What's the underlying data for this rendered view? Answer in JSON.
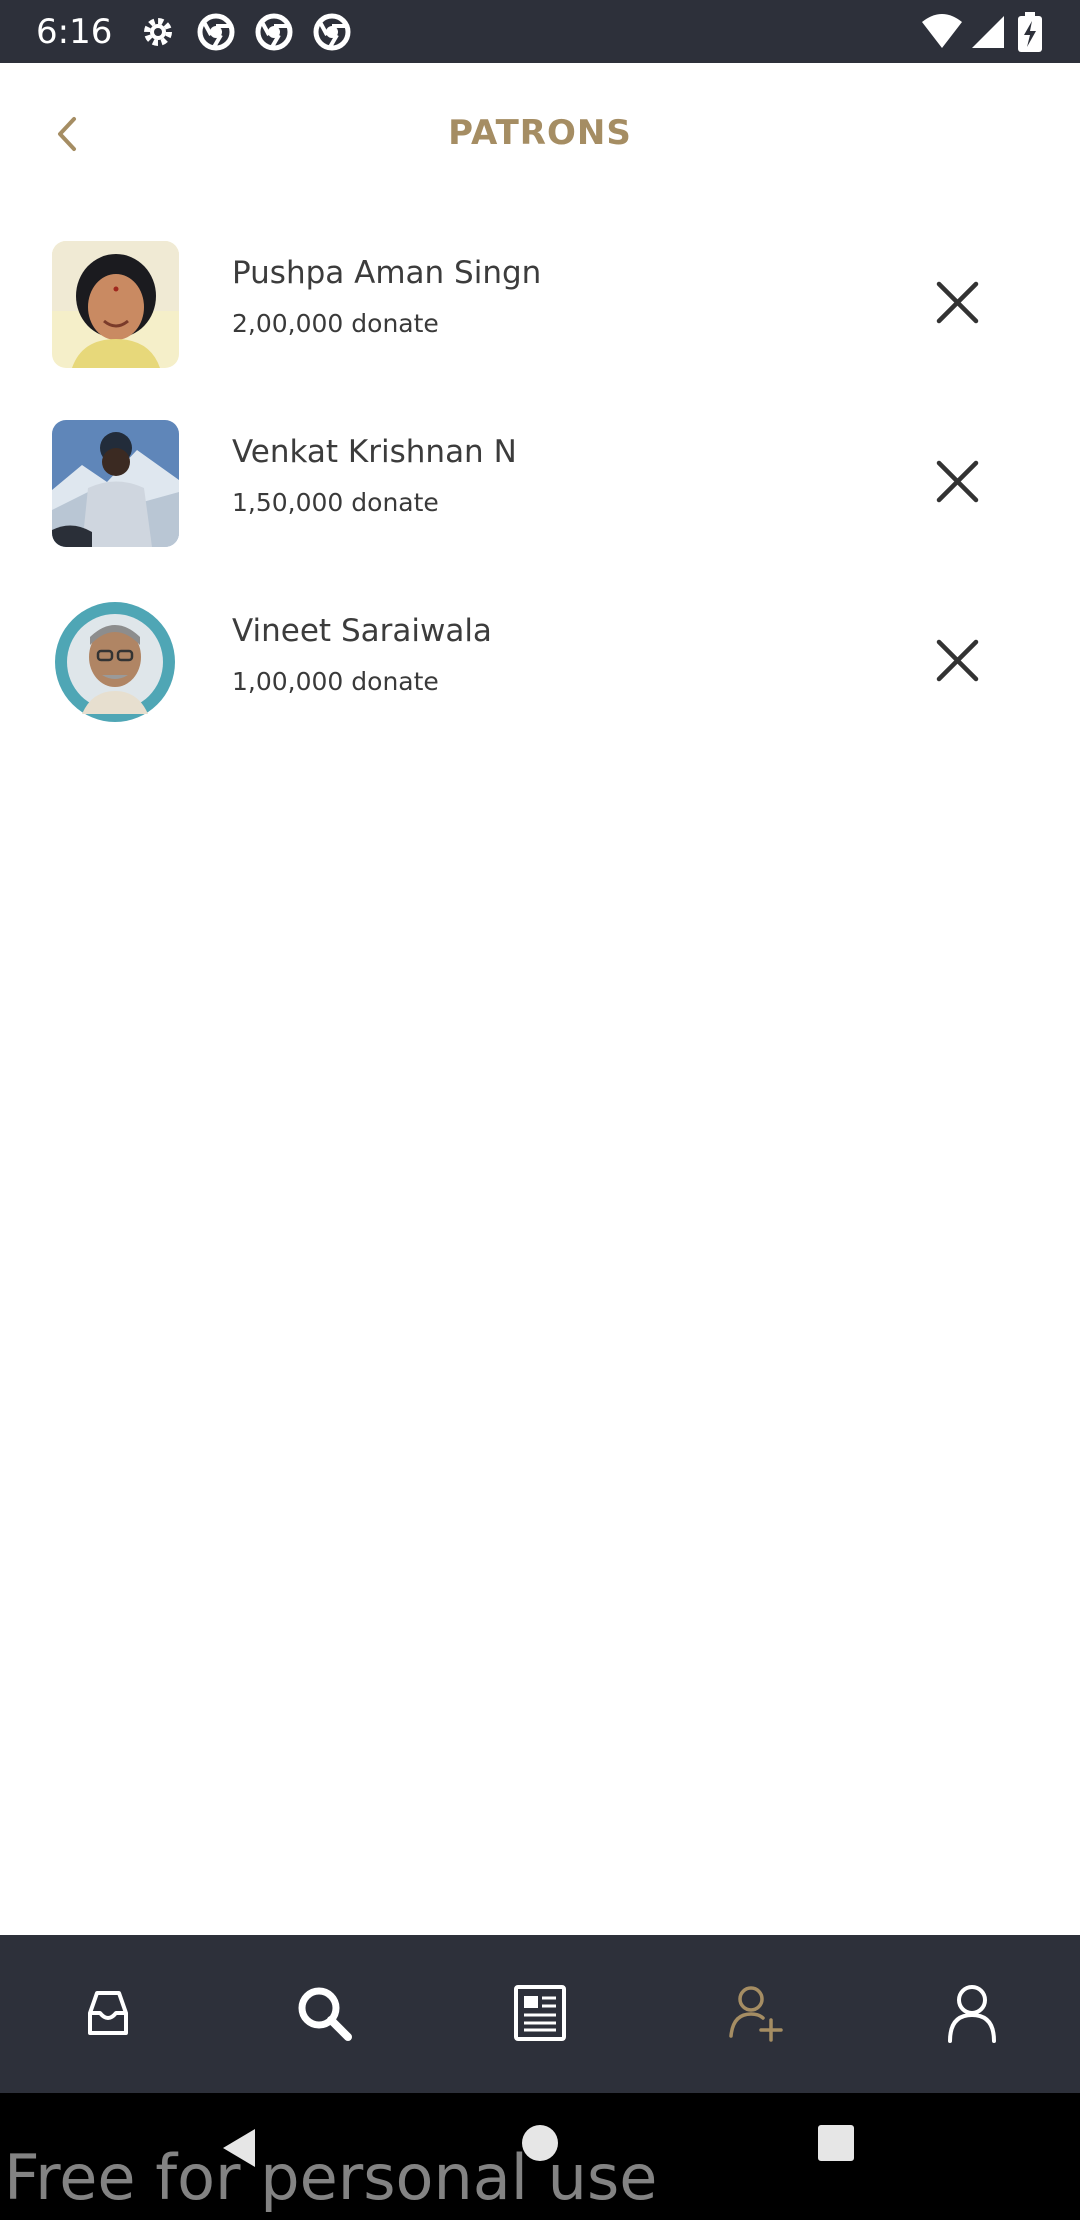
{
  "status_bar": {
    "time": "6:16",
    "icons": [
      "gear-icon",
      "chrome-icon",
      "chrome-icon",
      "chrome-icon",
      "wifi-icon",
      "signal-icon",
      "battery-icon"
    ]
  },
  "header": {
    "title": "PATRONS",
    "back_icon": "chevron-left-icon"
  },
  "patrons": [
    {
      "name": "Pushpa Aman Singn",
      "donation": "2,00,000 donate"
    },
    {
      "name": "Venkat Krishnan N",
      "donation": "1,50,000 donate"
    },
    {
      "name": "Vineet Saraiwala",
      "donation": "1,00,000 donate"
    }
  ],
  "bottom_nav": {
    "items": [
      {
        "icon": "inbox-icon",
        "active": false
      },
      {
        "icon": "search-icon",
        "active": false
      },
      {
        "icon": "news-icon",
        "active": false
      },
      {
        "icon": "add-user-icon",
        "active": true
      },
      {
        "icon": "profile-icon",
        "active": false
      }
    ]
  },
  "system_nav": {
    "watermark": "Free for personal use"
  },
  "colors": {
    "accent": "#a58d63",
    "dark_bar": "#2d303a",
    "text": "#3c3c3c"
  }
}
